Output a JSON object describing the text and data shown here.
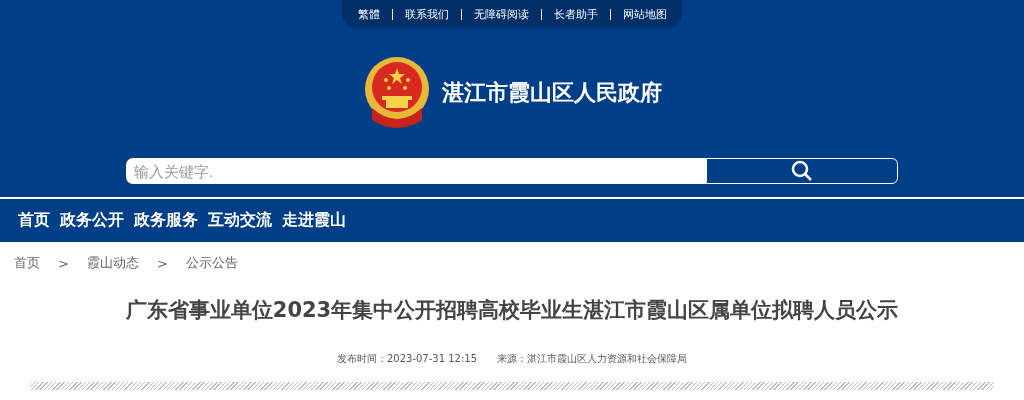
{
  "top_links": [
    "繁體",
    "联系我们",
    "无障碍阅读",
    "长者助手",
    "网站地图"
  ],
  "site_title": "湛江市霞山区人民政府",
  "search": {
    "placeholder": "输入关键字."
  },
  "nav": [
    "首页",
    "政务公开",
    "政务服务",
    "互动交流",
    "走进霞山"
  ],
  "breadcrumb": {
    "items": [
      "首页",
      "霞山动态",
      "公示公告"
    ],
    "separator": ">"
  },
  "article": {
    "title": "广东省事业单位2023年集中公开招聘高校毕业生湛江市霞山区属单位拟聘人员公示",
    "published": "发布时间：2023-07-31 12:15",
    "source": "来源：湛江市霞山区人力资源和社会保障局"
  }
}
